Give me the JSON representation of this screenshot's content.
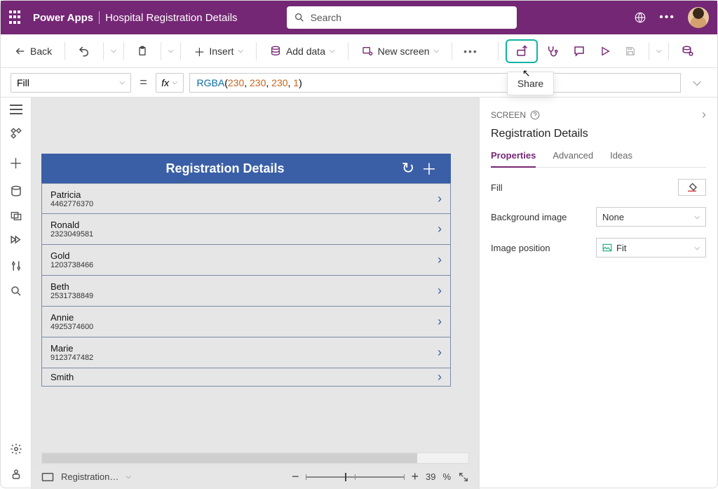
{
  "header": {
    "brand": "Power Apps",
    "app_name": "Hospital Registration Details",
    "search_placeholder": "Search"
  },
  "toolbar": {
    "back": "Back",
    "insert": "Insert",
    "add_data": "Add data",
    "new_screen": "New screen",
    "share_tooltip": "Share"
  },
  "formula": {
    "property": "Fill",
    "fx": "fx",
    "fn_name": "RGBA",
    "args": [
      "230",
      "230",
      "230",
      "1"
    ]
  },
  "canvas": {
    "title": "Registration Details",
    "rows": [
      {
        "name": "Patricia",
        "sub": "4462776370"
      },
      {
        "name": "Ronald",
        "sub": "2323049581"
      },
      {
        "name": "Gold",
        "sub": "1203738466"
      },
      {
        "name": "Beth",
        "sub": "2531738849"
      },
      {
        "name": "Annie",
        "sub": "4925374600"
      },
      {
        "name": "Marie",
        "sub": "9123747482"
      },
      {
        "name": "Smith",
        "sub": ""
      }
    ]
  },
  "footer": {
    "screen_label": "Registration…",
    "zoom_value": "39",
    "zoom_pct": "%"
  },
  "panel": {
    "crumb": "SCREEN",
    "title": "Registration Details",
    "tabs": {
      "properties": "Properties",
      "advanced": "Advanced",
      "ideas": "Ideas"
    },
    "fill_label": "Fill",
    "bgimg_label": "Background image",
    "bgimg_value": "None",
    "imgpos_label": "Image position",
    "imgpos_value": "Fit"
  }
}
